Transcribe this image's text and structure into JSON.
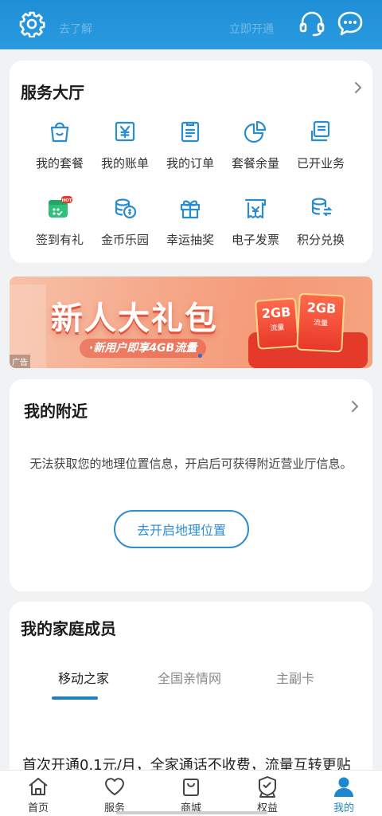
{
  "header": {
    "ghost_left": "去了解",
    "ghost_right": "立即开通",
    "settings_icon": "gear-icon",
    "service_icon": "headset-icon",
    "message_icon": "chat-bubble-icon"
  },
  "service_hall": {
    "title": "服务大厅",
    "row1": [
      {
        "label": "我的套餐",
        "icon": "shopping-bag-icon"
      },
      {
        "label": "我的账单",
        "icon": "yen-bill-icon"
      },
      {
        "label": "我的订单",
        "icon": "clipboard-list-icon"
      },
      {
        "label": "套餐余量",
        "icon": "pie-chart-icon"
      },
      {
        "label": "已开业务",
        "icon": "document-stack-icon"
      }
    ],
    "row2": [
      {
        "label": "签到有礼",
        "icon": "calendar-hot-icon",
        "badge": "HOT"
      },
      {
        "label": "金币乐园",
        "icon": "coin-stack-icon"
      },
      {
        "label": "幸运抽奖",
        "icon": "gift-box-icon"
      },
      {
        "label": "电子发票",
        "icon": "receipt-icon"
      },
      {
        "label": "积分兑换",
        "icon": "points-exchange-icon"
      }
    ]
  },
  "banner": {
    "headline": "新人大礼包",
    "subline": "·新用户即享4GB流量",
    "ad_tag": "广告",
    "card1": {
      "amount": "2GB",
      "sub": "流量"
    },
    "card2": {
      "amount": "2GB",
      "sub": "流量"
    }
  },
  "nearby": {
    "title": "我的附近",
    "message": "无法获取您的地理位置信息，开启后可获得附近营业厅信息。",
    "button_label": "去开启地理位置"
  },
  "family": {
    "title": "我的家庭成员",
    "tabs": [
      "移动之家",
      "全国亲情网",
      "主副卡"
    ],
    "active_tab": 0,
    "promo": "首次开通0.1元/月，全家通话不收费，流量互转更贴"
  },
  "bottom_nav": [
    {
      "label": "首页",
      "icon": "home-icon"
    },
    {
      "label": "服务",
      "icon": "heart-icon"
    },
    {
      "label": "商城",
      "icon": "shopping-bag-icon"
    },
    {
      "label": "权益",
      "icon": "badge-icon"
    },
    {
      "label": "我的",
      "icon": "user-icon",
      "active": true
    }
  ],
  "colors": {
    "header": "#2b9be0",
    "accent": "#1f86d0",
    "icon_blue": "#2a8cd0",
    "card_bg": "#ffffff",
    "page_bg": "#f1f2f4"
  }
}
